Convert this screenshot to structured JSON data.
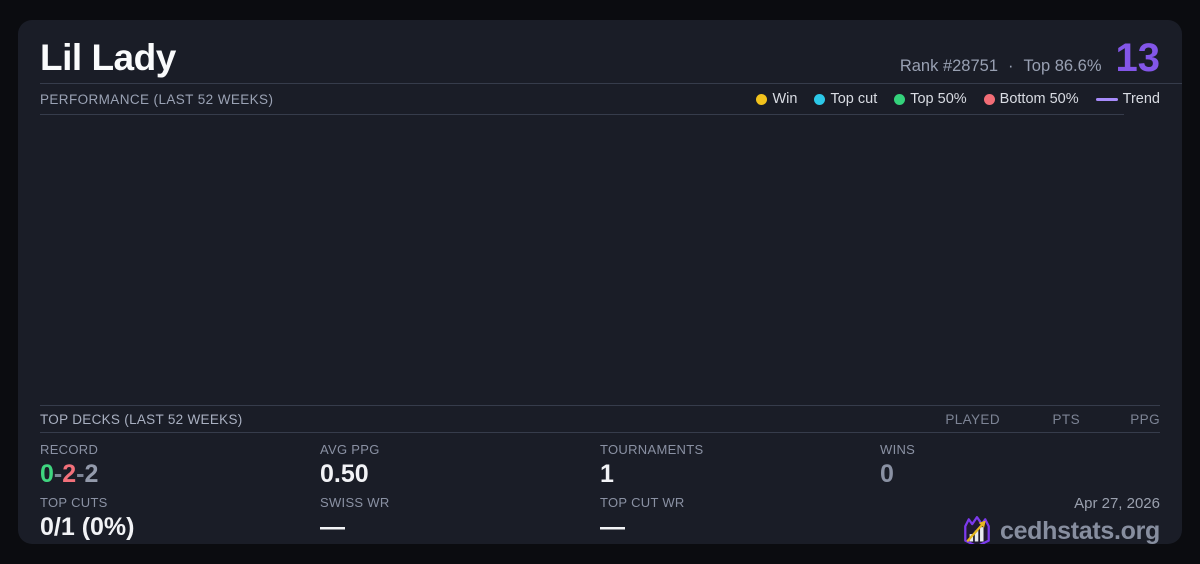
{
  "header": {
    "title": "Lil Lady",
    "rank_label": "Rank #28751",
    "separator": "·",
    "percentile_label": "Top 86.6%",
    "big_number": "13"
  },
  "performance": {
    "section_label": "PERFORMANCE (LAST 52 WEEKS)",
    "legend": [
      {
        "label": "Win",
        "color": "#f2c21c"
      },
      {
        "label": "Top cut",
        "color": "#2cc8e8"
      },
      {
        "label": "Top 50%",
        "color": "#34d27b"
      },
      {
        "label": "Bottom 50%",
        "color": "#f26d76"
      },
      {
        "label": "Trend",
        "color": "#a78bfa"
      }
    ]
  },
  "top_decks": {
    "section_label": "TOP DECKS (LAST 52 WEEKS)",
    "columns": [
      "PLAYED",
      "PTS",
      "PPG"
    ]
  },
  "stats": {
    "record": {
      "label": "RECORD",
      "wins": "0",
      "losses": "2",
      "draws": "2",
      "separator": "-"
    },
    "avg_ppg": {
      "label": "AVG PPG",
      "value": "0.50"
    },
    "tournaments": {
      "label": "TOURNAMENTS",
      "value": "1"
    },
    "wins": {
      "label": "WINS",
      "value": "0"
    },
    "top_cuts": {
      "label": "TOP CUTS",
      "value": "0/1 (0%)"
    },
    "swiss_wr": {
      "label": "SWISS WR",
      "value": "—"
    },
    "top_cut_wr": {
      "label": "TOP CUT WR",
      "value": "—"
    }
  },
  "footer": {
    "date": "Apr 27, 2026",
    "brand": "cedhstats.org"
  },
  "colors": {
    "page_bg": "#0b0c10",
    "card_bg": "#1a1d27",
    "divider": "#363c4b",
    "accent_purple": "#8356e8",
    "win": "#f2c21c",
    "top_cut": "#2cc8e8",
    "top_50": "#34d27b",
    "bottom_50": "#f26d76",
    "trend": "#a78bfa",
    "record_win": "#3fd57f",
    "record_loss": "#f2707a",
    "record_draw": "#939aab",
    "logo_purple": "#7c3aed",
    "logo_gold": "#e7b81f"
  }
}
